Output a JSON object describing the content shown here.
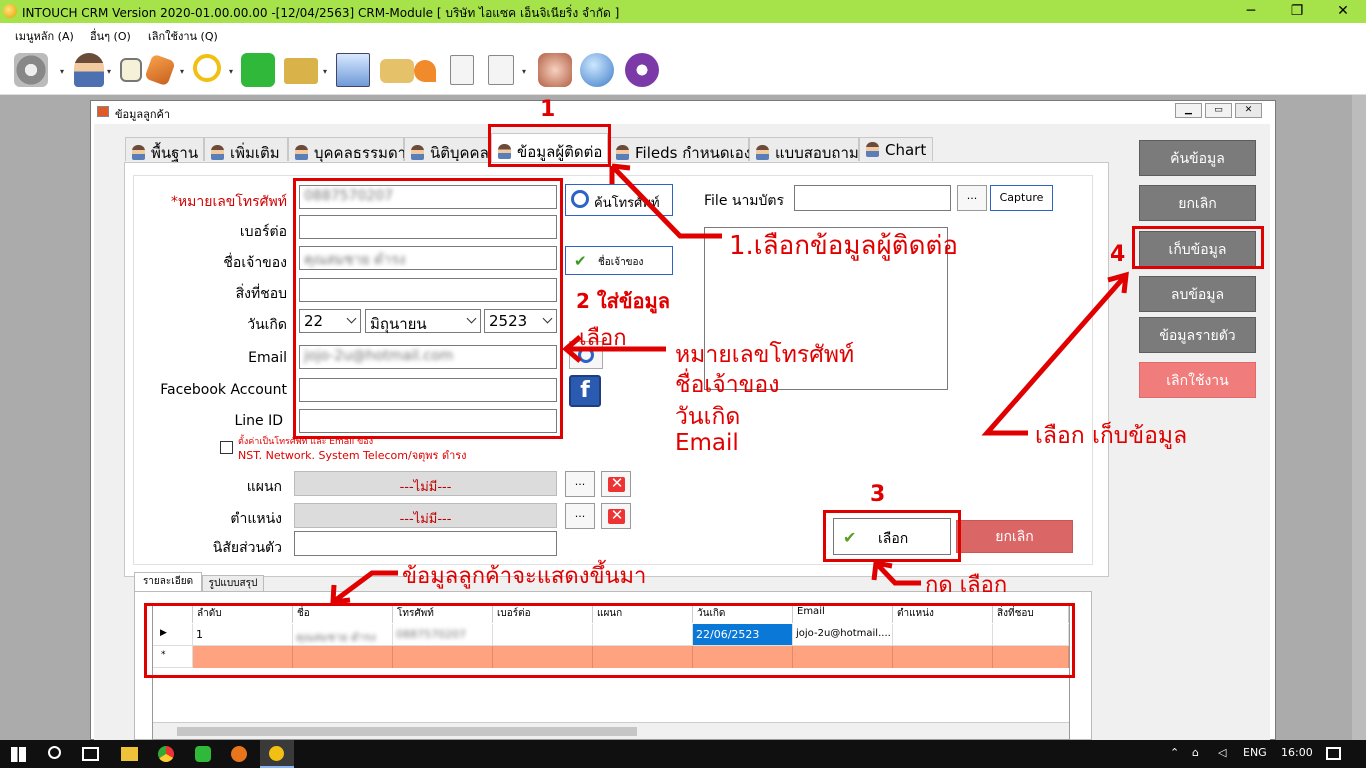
{
  "window": {
    "title": "INTOUCH CRM Version 2020-01.00.00.00 -[12/04/2563] CRM-Module  [ บริษัท ไอแซค เอ็นจิเนียริ่ง จำกัด ]"
  },
  "window_controls": {
    "minimize": "─",
    "maximize": "❐",
    "close": "✕"
  },
  "menubar": [
    "เมนูหลัก (A)",
    "อื่นๆ (O)",
    "เลิกใช้งาน (Q)"
  ],
  "toolbar_icons": [
    "gear-icon",
    "user-icon",
    "notes-icon",
    "pen-icon",
    "search-icon",
    "chat-icon",
    "folder-icon",
    "chart-icon",
    "hand-icon",
    "pin-icon",
    "document-icon",
    "report-icon",
    "gift-icon",
    "globe-box-icon",
    "podcast-icon"
  ],
  "child_window": {
    "title": "ข้อมูลลูกค้า",
    "controls": [
      "▁",
      "▭",
      "✕"
    ]
  },
  "tabs": [
    "พื้นฐาน",
    "เพิ่มเติม",
    "บุคคลธรรมดา",
    "นิติบุคคล",
    "ข้อมูลผู้ติดต่อ",
    "Fileds กำหนดเอง",
    "แบบสอบถาม",
    "Chart"
  ],
  "form": {
    "phone_label": "*หมายเลขโทรศัพท์",
    "phone_value": "0887570207",
    "ext_label": "เบอร์ต่อ",
    "owner_label": "ชื่อเจ้าของ",
    "owner_value": "คุณสมชาย ดำรง",
    "hobby_label": "สิ่งที่ชอบ",
    "birth_label": "วันเกิด",
    "birth_day": "22",
    "birth_month": "มิถุนายน",
    "birth_year": "2523",
    "email_label": "Email",
    "email_value": "jojo-2u@hotmail.com",
    "facebook_label": "Facebook Account",
    "line_label": "Line ID",
    "default_note_1": "ตั้งค่าเป็นโทรศัพท์ และ Email ของ",
    "default_note_2": "NST. Network. System Telecom/จตุพร ดำรง",
    "dept_label": "แผนก",
    "dept_value": "---ไม่มี---",
    "pos_label": "ตำแหน่ง",
    "pos_value": "---ไม่มี---",
    "trait_label": "นิสัยส่วนตัว",
    "search_phone_btn": "ค้นโทรศัพท์",
    "owner_btn": "ชื่อเจ้าของ",
    "ellipsis": "...",
    "clear": "✕",
    "file_label": "File นามบัตร",
    "capture_btn": "Capture",
    "select_btn": "เลือก",
    "cancel_btn": "ยกเลิก"
  },
  "side_buttons": [
    "ค้นข้อมูล",
    "ยกเลิก",
    "เก็บข้อมูล",
    "ลบข้อมูล",
    "ข้อมูลรายตัว",
    "เลิกใช้งาน"
  ],
  "sub_tabs": [
    "รายละเอียด",
    "รูปแบบสรุป"
  ],
  "grid": {
    "columns": [
      "ลำดับ",
      "ชื่อ",
      "โทรศัพท์",
      "เบอร์ต่อ",
      "แผนก",
      "วันเกิด",
      "Email",
      "ตำแหน่ง",
      "สิ่งที่ชอบ"
    ],
    "rows": [
      [
        "1",
        "คุณสมชาย ดำรง",
        "0887570207",
        "",
        "",
        "22/06/2523",
        "jojo-2u@hotmail....",
        "",
        ""
      ]
    ],
    "row_marker": "▶",
    "new_marker": "*"
  },
  "annotations": {
    "n1": "1",
    "n2": "2",
    "n3": "3",
    "n4": "4",
    "a1": "1.เลือกข้อมูลผู้ติดต่อ",
    "a2_title": "2  ใส่ข้อมูล",
    "a2_sub": "เลือก",
    "a2_list": [
      "หมายเลขโทรศัพท์",
      "ชื่อเจ้าของ",
      "วันเกิด",
      "Email"
    ],
    "a3": "กด เลือก",
    "a4": "เลือก เก็บข้อมูล",
    "grid_note": "ข้อมูลลูกค้าจะแสดงขึ้นมา"
  },
  "taskbar": {
    "lang": "ENG",
    "time": "16:00"
  },
  "colors": {
    "titlebar": "#a6e34a",
    "annotation": "#e00000",
    "button_gray": "#7b7b7b",
    "button_pink": "#f07c7c",
    "new_row": "#ffa27f",
    "selected_cell": "#0a78d7"
  }
}
